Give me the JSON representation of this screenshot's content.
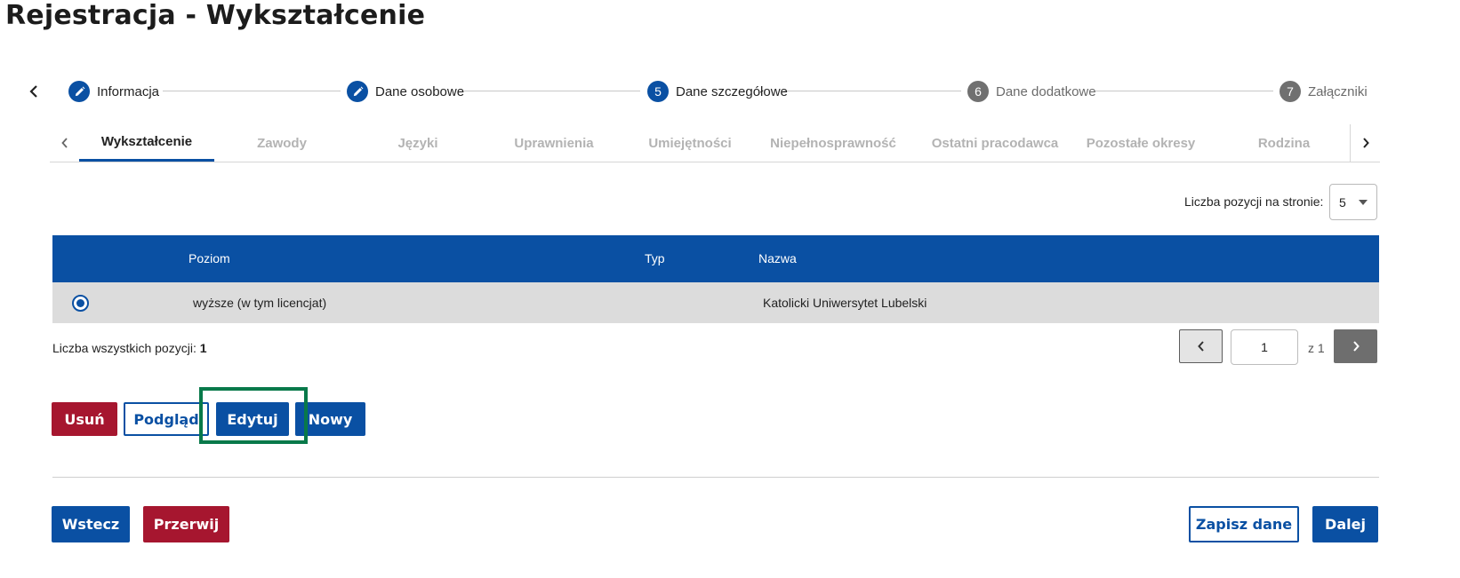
{
  "page": {
    "title": "Rejestracja - Wykształcenie"
  },
  "stepper": {
    "steps": [
      {
        "label": "Informacja",
        "number": "",
        "state": "done"
      },
      {
        "label": "Dane osobowe",
        "number": "",
        "state": "done"
      },
      {
        "label": "Dane szczegółowe",
        "number": "5",
        "state": "active"
      },
      {
        "label": "Dane dodatkowe",
        "number": "6",
        "state": "todo"
      },
      {
        "label": "Załączniki",
        "number": "7",
        "state": "todo"
      }
    ]
  },
  "tabs": [
    {
      "label": "Wykształcenie",
      "active": true
    },
    {
      "label": "Zawody",
      "active": false
    },
    {
      "label": "Języki",
      "active": false
    },
    {
      "label": "Uprawnienia",
      "active": false
    },
    {
      "label": "Umiejętności",
      "active": false
    },
    {
      "label": "Niepełnosprawność",
      "active": false
    },
    {
      "label": "Ostatni pracodawca",
      "active": false
    },
    {
      "label": "Pozostałe okresy",
      "active": false
    },
    {
      "label": "Rodzina",
      "active": false
    }
  ],
  "per_page": {
    "label": "Liczba pozycji na stronie:",
    "value": "5"
  },
  "table": {
    "headers": {
      "level": "Poziom",
      "type": "Typ",
      "name": "Nazwa"
    },
    "rows": [
      {
        "level": "wyższe (w tym licencjat)",
        "type": "",
        "name": "Katolicki Uniwersytet Lubelski",
        "selected": true
      }
    ]
  },
  "total": {
    "label": "Liczba wszystkich pozycji:",
    "value": "1"
  },
  "pagination": {
    "page": "1",
    "of_label": "z 1"
  },
  "actions": {
    "delete": "Usuń",
    "preview": "Podgląd",
    "edit": "Edytuj",
    "new": "Nowy"
  },
  "footer": {
    "back": "Wstecz",
    "abort": "Przerwij",
    "save": "Zapisz dane",
    "next": "Dalej"
  },
  "colors": {
    "primary": "#0a50a3",
    "danger": "#a6162f",
    "highlight": "#08794a",
    "row_selected": "#dcdcdc"
  }
}
